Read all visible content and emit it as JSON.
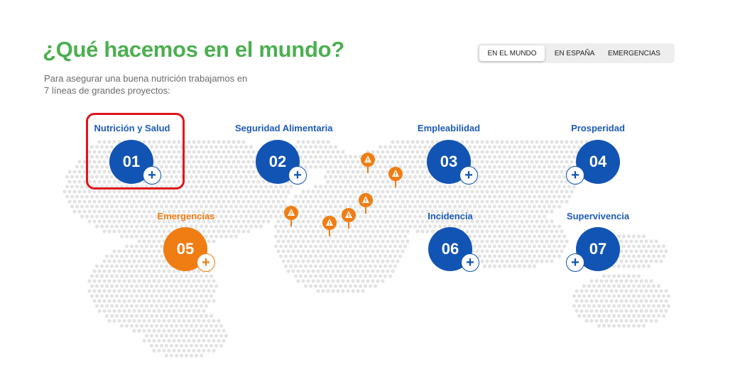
{
  "header": {
    "title": "¿Qué hacemos en el mundo?",
    "subtitle_line1": "Para asegurar una buena nutrición trabajamos en",
    "subtitle_line2": "7 líneas de grandes proyectos:"
  },
  "tabs": [
    {
      "label": "EN EL MUNDO",
      "active": true
    },
    {
      "label": "EN ESPAÑA",
      "active": false
    },
    {
      "label": "EMERGENCIAS",
      "active": false
    }
  ],
  "lines": [
    {
      "label": "Nutrición y Salud",
      "number": "01",
      "color": "blue",
      "highlighted": true
    },
    {
      "label": "Seguridad Alimentaria",
      "number": "02",
      "color": "blue"
    },
    {
      "label": "Empleabilidad",
      "number": "03",
      "color": "blue"
    },
    {
      "label": "Prosperidad",
      "number": "04",
      "color": "blue"
    },
    {
      "label": "Emergencias",
      "number": "05",
      "color": "orange"
    },
    {
      "label": "Incidencia",
      "number": "06",
      "color": "blue"
    },
    {
      "label": "Supervivencia",
      "number": "07",
      "color": "blue"
    }
  ],
  "plus_symbol": "+",
  "colors": {
    "title_green": "#4caf50",
    "primary_blue": "#1254b3",
    "emergency_orange": "#f07d13",
    "highlight_red": "#e0141c",
    "map_dots": "#e3e3e3"
  },
  "icons": {
    "map_pin": "warning-map-pin-icon",
    "expand": "plus-icon"
  }
}
